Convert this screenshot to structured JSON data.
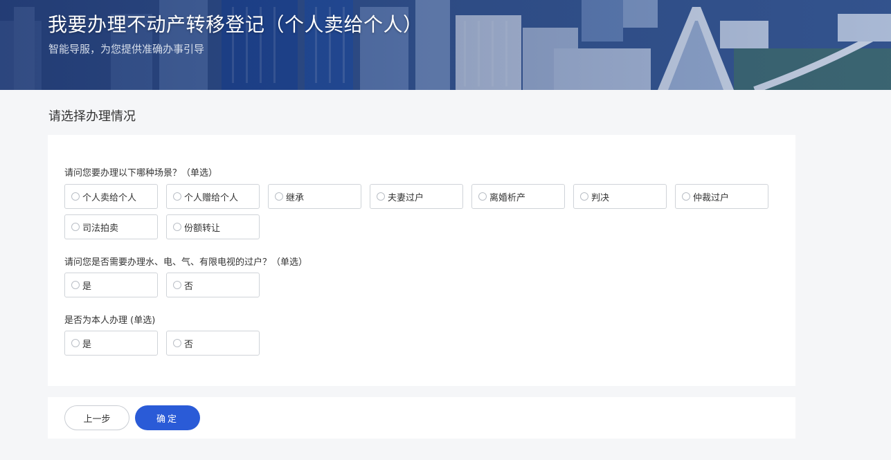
{
  "banner": {
    "title": "我要办理不动产转移登记（个人卖给个人）",
    "subtitle": "智能导服，为您提供准确办事引导"
  },
  "section_heading": "请选择办理情况",
  "questions": [
    {
      "text": "请问您要办理以下哪种场景？（单选）",
      "options": [
        {
          "label": "个人卖给个人",
          "selected": false
        },
        {
          "label": "个人赠给个人",
          "selected": false
        },
        {
          "label": "继承",
          "selected": false
        },
        {
          "label": "夫妻过户",
          "selected": false
        },
        {
          "label": "离婚析产",
          "selected": false
        },
        {
          "label": "判决",
          "selected": false
        },
        {
          "label": "仲裁过户",
          "selected": false
        },
        {
          "label": "司法拍卖",
          "selected": false
        },
        {
          "label": "份额转让",
          "selected": false
        }
      ]
    },
    {
      "text": "请问您是否需要办理水、电、气、有限电视的过户？（单选）",
      "options": [
        {
          "label": "是",
          "selected": false
        },
        {
          "label": "否",
          "selected": false
        }
      ]
    },
    {
      "text": "是否为本人办理 (单选)",
      "options": [
        {
          "label": "是",
          "selected": false
        },
        {
          "label": "否",
          "selected": false
        }
      ]
    }
  ],
  "footer": {
    "prev_label": "上一步",
    "confirm_label": "确定"
  },
  "colors": {
    "primary": "#2a5bd7",
    "page_bg": "#f5f6f8",
    "border": "#cfd3d8"
  }
}
